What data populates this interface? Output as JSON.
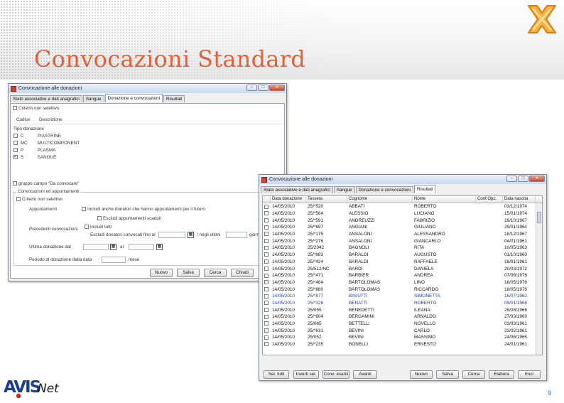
{
  "slide": {
    "title": "Convocazioni Standard",
    "page_number": "9",
    "brand": "AVIS",
    "brand_suffix": "Net"
  },
  "window1": {
    "title": "Convocazione alle donazioni",
    "tabs": [
      "Stato associative e dati anagrafici",
      "Sangue",
      "Donazione e convocazioni",
      "Risultati"
    ],
    "active_tab": "Donazione e convocazioni",
    "filter_checkbox_label": "Criterio non selettivo",
    "columns": [
      "Codice",
      "Descrizione"
    ],
    "section_tipo": "Tipo donazione",
    "donation_types": [
      {
        "code": "C",
        "desc": "PIASTRINE",
        "checked": false
      },
      {
        "code": "MC",
        "desc": "MULTICOMPONENT",
        "checked": false
      },
      {
        "code": "P",
        "desc": "PLASMA",
        "checked": false
      },
      {
        "code": "S",
        "desc": "SANGUE",
        "checked": true
      }
    ],
    "group_checkbox_label": "gruppo campo \"Da convocare\"",
    "appointments_section": "Convocazioni ed appuntamenti",
    "appointments_criteria": "Criterio non selettivo",
    "appointments_label": "Appuntamenti",
    "appointments_option": "Includi anche donatori che hanno appuntamenti per il futuro",
    "appointments_sub_option": "Escludi appuntamenti scaduti",
    "previous_convocations_label": "Precedenti convocazioni",
    "include_all_label": "Includi tutti",
    "exclude_label": "Escludi donatori convocati fino al",
    "days_label": "/ negli ultimi",
    "days_suffix": "giorni",
    "last_donation_label": "Ultima donazione dal",
    "last_donation_to": "al",
    "interval_label": "Periodo di donazione dalla data",
    "interval_suffix": "mese",
    "buttons": [
      "Nuovo",
      "Salva",
      "Cerca",
      "Chiudi"
    ]
  },
  "window2": {
    "title": "Convocazione alle donazioni",
    "tabs": [
      "Stato associative e dati anagrafici",
      "Sangue",
      "Donazione e convocazioni",
      "Risultati"
    ],
    "active_tab": "Risultati",
    "columns": [
      "",
      "Data donazione",
      "Tessera",
      "Cognome",
      "Nome",
      "Conf.Opz.",
      "Data nascita"
    ],
    "rows": [
      {
        "date": "14/05/2010",
        "card": "25/*520",
        "surname": "ABBATI",
        "name": "ROBERTO",
        "birth": "03/12/1974",
        "blue": false
      },
      {
        "date": "14/05/2010",
        "card": "25/*564",
        "surname": "ALESSIO",
        "name": "LUCIANO",
        "birth": "15/01/1974",
        "blue": false
      },
      {
        "date": "14/05/2010",
        "card": "25/*591",
        "surname": "ANDREUZZI",
        "name": "FABRIZIO",
        "birth": "19/10/1967",
        "blue": false
      },
      {
        "date": "14/05/2010",
        "card": "25/*697",
        "surname": "ANGIANI",
        "name": "GIULIANO",
        "birth": "29/01/1964",
        "blue": false
      },
      {
        "date": "14/05/2010",
        "card": "25/*175",
        "surname": "ANSALONI",
        "name": "ALESSANDRO",
        "birth": "18/12/1967",
        "blue": false
      },
      {
        "date": "14/05/2010",
        "card": "25/*276",
        "surname": "ANSALONI",
        "name": "GIANCARLO",
        "birth": "04/01/1961",
        "blue": false
      },
      {
        "date": "14/05/2010",
        "card": "25/2042",
        "surname": "BAGNOLI",
        "name": "RITA",
        "birth": "10/05/1963",
        "blue": false
      },
      {
        "date": "14/05/2010",
        "card": "25/*683",
        "surname": "BARALDI",
        "name": "AUGUSTO",
        "birth": "01/10/1960",
        "blue": false
      },
      {
        "date": "14/05/2010",
        "card": "25/*424",
        "surname": "BARALDI",
        "name": "RAFFAELE",
        "birth": "16/01/1961",
        "blue": false
      },
      {
        "date": "14/05/2010",
        "card": "25/512/NC",
        "surname": "BARDI",
        "name": "DANIELA",
        "birth": "20/03/1972",
        "blue": false
      },
      {
        "date": "14/05/2010",
        "card": "25/*471",
        "surname": "BARBIER",
        "name": "ANDREA",
        "birth": "07/06/1976",
        "blue": false
      },
      {
        "date": "14/05/2010",
        "card": "25/*484",
        "surname": "BARTOLOMAS",
        "name": "LINO",
        "birth": "18/05/1976",
        "blue": false
      },
      {
        "date": "14/05/2010",
        "card": "25/*880",
        "surname": "BARTOLOMAS",
        "name": "RICCARDO",
        "birth": "18/05/1976",
        "blue": false
      },
      {
        "date": "14/05/2010",
        "card": "25/*877",
        "surname": "BAVUTTI",
        "name": "SIMONETTA",
        "birth": "16/07/1962",
        "blue": true
      },
      {
        "date": "14/05/2010",
        "card": "25/*326",
        "surname": "BENATTI",
        "name": "ROBERTO",
        "birth": "09/01/1968",
        "blue": true
      },
      {
        "date": "14/05/2010",
        "card": "25/055",
        "surname": "BENEDETTI",
        "name": "ILEANA",
        "birth": "28/08/1966",
        "blue": false
      },
      {
        "date": "14/05/2010",
        "card": "25/*604",
        "surname": "BERGAMINI",
        "name": "ARNALDO",
        "birth": "27/03/1960",
        "blue": false
      },
      {
        "date": "14/05/2010",
        "card": "25/065",
        "surname": "BETTELLI",
        "name": "NOVELLO",
        "birth": "03/03/1961",
        "blue": false
      },
      {
        "date": "14/05/2010",
        "card": "25/*631",
        "surname": "BEVINI",
        "name": "CARLO",
        "birth": "23/02/1961",
        "blue": false
      },
      {
        "date": "14/05/2010",
        "card": "25/052",
        "surname": "BEVINI",
        "name": "MASSIMO",
        "birth": "24/06/1965",
        "blue": false
      },
      {
        "date": "14/05/2010",
        "card": "25/*235",
        "surname": "BONELLI",
        "name": "ERNESTO",
        "birth": "24/01/1961",
        "blue": false
      }
    ],
    "buttons_left": [
      "Sel. tutti",
      "Inverti sel.",
      "Conv. esami",
      "Avanti"
    ],
    "buttons_right": [
      "Nuovo",
      "Salva",
      "Cerca",
      "Elabora",
      "Esci"
    ]
  },
  "icons": {
    "logo": "x-logo-icon",
    "avis": "avis-logo-icon",
    "calendar": "calendar-icon"
  },
  "colors": {
    "title": "#e0623a",
    "accent_blue": "#1f3fa8",
    "logo_orange": "#f08a1e"
  }
}
